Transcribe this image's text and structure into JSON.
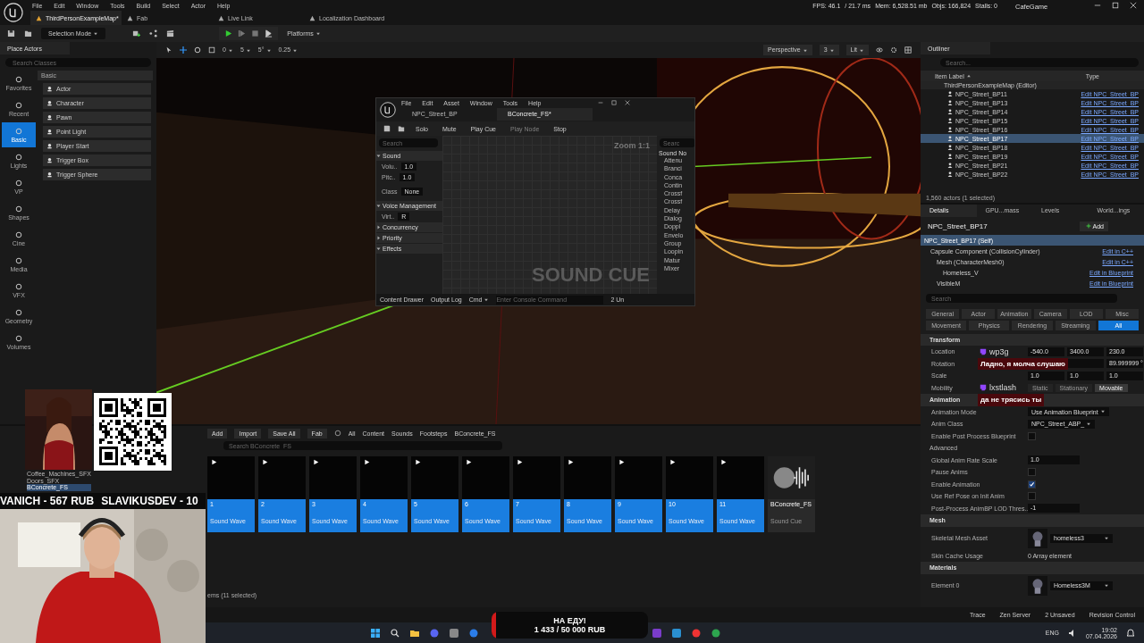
{
  "menu": [
    "File",
    "Edit",
    "Window",
    "Tools",
    "Build",
    "Select",
    "Actor",
    "Help"
  ],
  "tabs": [
    {
      "label": "ThirdPersonExampleMap*",
      "selected": true
    },
    {
      "label": "Fab",
      "selected": false
    },
    {
      "label": "Live Link",
      "selected": false
    },
    {
      "label": "Localization Dashboard",
      "selected": false
    }
  ],
  "stats": [
    "FPS: 46.1",
    "/ 21.7 ms",
    "Mem: 6,528.51 mb",
    "Objs: 166,824",
    "Stalls: 0"
  ],
  "project": "CafeGame",
  "toolbar": {
    "mode": "Selection Mode",
    "platforms": "Platforms"
  },
  "place_actors": {
    "title": "Place Actors",
    "search_placeholder": "Search Classes",
    "section": "Basic",
    "categories": [
      {
        "label": "Favorites",
        "selected": false
      },
      {
        "label": "Recent",
        "selected": false
      },
      {
        "label": "Basic",
        "selected": true
      },
      {
        "label": "Lights",
        "selected": false
      },
      {
        "label": "VP",
        "selected": false
      },
      {
        "label": "Shapes",
        "selected": false
      },
      {
        "label": "Cine",
        "selected": false
      },
      {
        "label": "Media",
        "selected": false
      },
      {
        "label": "VFX",
        "selected": false
      },
      {
        "label": "Geometry",
        "selected": false
      },
      {
        "label": "Volumes",
        "selected": false
      }
    ],
    "items": [
      "Actor",
      "Character",
      "Pawn",
      "Point Light",
      "Player Start",
      "Trigger Box",
      "Trigger Sphere"
    ]
  },
  "viewport": {
    "snap_values": [
      "0",
      "5",
      "5°",
      "0.25"
    ],
    "view": "Perspective",
    "camera_speed": "3",
    "mode": "Lit"
  },
  "sound_cue": {
    "menu": [
      "File",
      "Edit",
      "Asset",
      "Window",
      "Tools",
      "Help"
    ],
    "tabs": [
      {
        "label": "NPC_Street_BP",
        "selected": false
      },
      {
        "label": "BConcrete_FS*",
        "selected": true
      }
    ],
    "toolbar": [
      {
        "label": "Solo",
        "disabled": false
      },
      {
        "label": "Mute",
        "disabled": false
      },
      {
        "label": "Play Cue",
        "disabled": false
      },
      {
        "label": "Play Node",
        "disabled": true
      },
      {
        "label": "Stop",
        "disabled": false
      }
    ],
    "search_placeholder": "Search",
    "sections": [
      {
        "title": "Sound",
        "expanded": true,
        "rows": [
          {
            "label": "Volu..",
            "kind": "number",
            "value": "1.0"
          },
          {
            "label": "Pitc..",
            "kind": "number",
            "value": "1.0"
          },
          {
            "label": "Class",
            "kind": "asset",
            "value": "None"
          }
        ]
      },
      {
        "title": "Voice Management",
        "expanded": true,
        "rows": [
          {
            "label": "Virt..",
            "kind": "dropdown",
            "value": "R"
          }
        ]
      },
      {
        "title": "Concurrency",
        "expanded": false
      },
      {
        "title": "Priority",
        "expanded": false
      },
      {
        "title": "Effects",
        "expanded": true
      }
    ],
    "zoom": "Zoom 1:1",
    "watermark": "SOUND CUE",
    "palette": {
      "placeholder": "Searc",
      "heading": "Sound No",
      "items": [
        "Attenu",
        "Branci",
        "Conca",
        "Contin",
        "Crossf",
        "Crossf",
        "Delay",
        "Dialog",
        "Doppl",
        "Envelo",
        "Group",
        "Loopin",
        "Matur",
        "Mixer"
      ]
    },
    "footer": {
      "drawer": "Content Drawer",
      "log": "Output Log",
      "cmd": "Cmd",
      "console_placeholder": "Enter Console Command",
      "unsaved": "2 Un"
    }
  },
  "content_browser": {
    "buttons": [
      "Add",
      "Import",
      "Save All",
      "Fab"
    ],
    "path": [
      "All",
      "Content",
      "Sounds",
      "Footsteps",
      "BConcrete_FS"
    ],
    "search_placeholder": "Search BConcrete_FS",
    "folders": [
      {
        "label": "Coffee_Machines_SFX",
        "selected": false
      },
      {
        "label": "Doors_SFX",
        "selected": false
      },
      {
        "label": "BConcrete_FS",
        "selected": true
      }
    ],
    "assets": [
      {
        "name": "1",
        "type": "Sound Wave",
        "kind": "wave",
        "selected": true
      },
      {
        "name": "2",
        "type": "Sound Wave",
        "kind": "wave",
        "selected": true
      },
      {
        "name": "3",
        "type": "Sound Wave",
        "kind": "wave",
        "selected": true
      },
      {
        "name": "4",
        "type": "Sound Wave",
        "kind": "wave",
        "selected": true
      },
      {
        "name": "5",
        "type": "Sound Wave",
        "kind": "wave",
        "selected": true
      },
      {
        "name": "6",
        "type": "Sound Wave",
        "kind": "wave",
        "selected": true
      },
      {
        "name": "7",
        "type": "Sound Wave",
        "kind": "wave",
        "selected": true
      },
      {
        "name": "8",
        "type": "Sound Wave",
        "kind": "wave",
        "selected": true
      },
      {
        "name": "9",
        "type": "Sound Wave",
        "kind": "wave",
        "selected": true
      },
      {
        "name": "10",
        "type": "Sound Wave",
        "kind": "wave",
        "selected": true
      },
      {
        "name": "11",
        "type": "Sound Wave",
        "kind": "wave",
        "selected": true
      },
      {
        "name": "BConcrete_FS",
        "type": "Sound Cue",
        "kind": "cue",
        "selected": false
      }
    ],
    "footer": "ems (11 selected)"
  },
  "outliner": {
    "title": "Outliner",
    "search_placeholder": "Search...",
    "col_label": "Item Label",
    "col_type": "Type",
    "root": "ThirdPersonExampleMap (Editor)",
    "rows": [
      {
        "label": "NPC_Street_BP11",
        "type": "Edit NPC_Street_BP",
        "selected": false
      },
      {
        "label": "NPC_Street_BP13",
        "type": "Edit NPC_Street_BP",
        "selected": false
      },
      {
        "label": "NPC_Street_BP14",
        "type": "Edit NPC_Street_BP",
        "selected": false
      },
      {
        "label": "NPC_Street_BP15",
        "type": "Edit NPC_Street_BP",
        "selected": false
      },
      {
        "label": "NPC_Street_BP16",
        "type": "Edit NPC_Street_BP",
        "selected": false
      },
      {
        "label": "NPC_Street_BP17",
        "type": "Edit NPC_Street_BP",
        "selected": true
      },
      {
        "label": "NPC_Street_BP18",
        "type": "Edit NPC_Street_BP",
        "selected": false
      },
      {
        "label": "NPC_Street_BP19",
        "type": "Edit NPC_Street_BP",
        "selected": false
      },
      {
        "label": "NPC_Street_BP21",
        "type": "Edit NPC_Street_BP",
        "selected": false
      },
      {
        "label": "NPC_Street_BP22",
        "type": "Edit NPC_Street_BP",
        "selected": false
      }
    ],
    "footer": "1,560 actors (1 selected)"
  },
  "details": {
    "tabs": [
      {
        "label": "Details",
        "selected": true
      },
      {
        "label": "GPU...mass",
        "selected": false
      },
      {
        "label": "Levels",
        "selected": false
      },
      {
        "label": "World...ings",
        "selected": false
      }
    ],
    "title": "NPC_Street_BP17",
    "add": "Add",
    "components": [
      {
        "label": "NPC_Street_BP17 (Self)",
        "selected": true,
        "children": [
          {
            "label": "Capsule Component (CollisionCylinder)",
            "action": "Edit in C++",
            "selected": false,
            "children": [
              {
                "label": "Mesh (CharacterMesh0)",
                "action": "Edit in C++",
                "selected": false,
                "children": [
                  {
                    "label": "Homeless_V",
                    "action": "Edit in Blueprint",
                    "selected": false
                  }
                ]
              },
              {
                "label": "VisibleM",
                "action": "Edit in Blueprint",
                "selected": false
              }
            ]
          }
        ]
      }
    ],
    "search_placeholder": "Search",
    "filters": [
      [
        {
          "label": "General",
          "selected": false
        },
        {
          "label": "Actor",
          "selected": false
        },
        {
          "label": "Animation",
          "selected": false
        },
        {
          "label": "Camera",
          "selected": false
        },
        {
          "label": "LOD",
          "selected": false
        },
        {
          "label": "Misc",
          "selected": false
        }
      ],
      [
        {
          "label": "Movement",
          "selected": false
        },
        {
          "label": "Physics",
          "selected": false
        },
        {
          "label": "Rendering",
          "selected": false
        },
        {
          "label": "Streaming",
          "selected": false
        },
        {
          "label": "All",
          "selected": true
        }
      ]
    ],
    "sections": [
      {
        "title": "Transform",
        "rows": [
          {
            "label": "Location",
            "kind": "vector",
            "values": [
              "-540.0",
              "3400.0",
              "230.0"
            ]
          },
          {
            "label": "Rotation",
            "kind": "vector",
            "values": [
              "89.999999 °"
            ]
          },
          {
            "label": "Scale",
            "kind": "vector",
            "values": [
              "1.0",
              "1.0",
              "1.0"
            ]
          },
          {
            "label": "Mobility",
            "kind": "options",
            "options": [
              {
                "label": "Static",
                "selected": false
              },
              {
                "label": "Stationary",
                "selected": false
              },
              {
                "label": "Movable",
                "selected": true
              }
            ]
          }
        ]
      },
      {
        "title": "Animation",
        "rows": [
          {
            "label": "Animation Mode",
            "kind": "dropdown",
            "value": "Use Animation Blueprint"
          },
          {
            "label": "Anim Class",
            "kind": "dropdown",
            "value": "NPC_Street_ABP_"
          },
          {
            "label": "Enable Post Process Blueprint",
            "kind": "checkbox",
            "checked": false
          },
          {
            "label": "Advanced",
            "kind": "subsection"
          },
          {
            "label": "Global Anim Rate Scale",
            "kind": "number",
            "value": "1.0"
          },
          {
            "label": "Pause Anims",
            "kind": "checkbox",
            "checked": false
          },
          {
            "label": "Enable Animation",
            "kind": "checkbox",
            "checked": true
          },
          {
            "label": "Use Ref Pose on Init Anim",
            "kind": "checkbox",
            "checked": false
          },
          {
            "label": "Post-Process AnimBP LOD Thres...",
            "kind": "number",
            "value": "-1"
          }
        ]
      },
      {
        "title": "Mesh",
        "rows": [
          {
            "label": "Skeletal Mesh Asset",
            "kind": "asset",
            "value": "homeless3"
          },
          {
            "label": "Skin Cache Usage",
            "kind": "text",
            "value": "0 Array element"
          }
        ]
      },
      {
        "title": "Materials",
        "rows": [
          {
            "label": "Element 0",
            "kind": "asset",
            "value": "Homeless3M"
          }
        ]
      }
    ]
  },
  "status_bar": [
    "Trace",
    "Zen Server",
    "2 Unsaved",
    "Revision Control"
  ],
  "taskbar": {
    "lang": "ENG",
    "time": "19:02",
    "date": "07.04.2026"
  },
  "stream": {
    "ticker": [
      "VANICH - 567 RUB",
      "SLAVIKUSDEV - 10"
    ],
    "chat": [
      {
        "user": "wp3g",
        "text": "Ладно, я молча слушаю"
      },
      {
        "user": "lxstlash",
        "text": "да не трясись ты"
      }
    ],
    "goal": {
      "title": "НА ЕДУ!",
      "amount": "1 433 / 50 000 RUB",
      "level": 0.029
    }
  }
}
